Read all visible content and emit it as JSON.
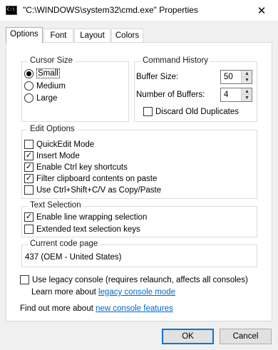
{
  "window": {
    "title": "\"C:\\WINDOWS\\system32\\cmd.exe\" Properties",
    "icon": "cmd-icon",
    "icon_text": "C:\\",
    "close_symbol": "✕"
  },
  "tabs": [
    {
      "label": "Options",
      "active": true
    },
    {
      "label": "Font",
      "active": false
    },
    {
      "label": "Layout",
      "active": false
    },
    {
      "label": "Colors",
      "active": false
    }
  ],
  "cursor_size": {
    "title": "Cursor Size",
    "options": [
      {
        "label": "Small",
        "checked": true
      },
      {
        "label": "Medium",
        "checked": false
      },
      {
        "label": "Large",
        "checked": false
      }
    ]
  },
  "command_history": {
    "title": "Command History",
    "buffer_size_label": "Buffer Size:",
    "buffer_size_value": "50",
    "num_buffers_label": "Number of Buffers:",
    "num_buffers_value": "4",
    "discard_label": "Discard Old Duplicates",
    "discard_checked": false
  },
  "edit_options": {
    "title": "Edit Options",
    "items": [
      {
        "label": "QuickEdit Mode",
        "checked": false
      },
      {
        "label": "Insert Mode",
        "checked": true
      },
      {
        "label": "Enable Ctrl key shortcuts",
        "checked": true
      },
      {
        "label": "Filter clipboard contents on paste",
        "checked": true
      },
      {
        "label": "Use Ctrl+Shift+C/V as Copy/Paste",
        "checked": false
      }
    ]
  },
  "text_selection": {
    "title": "Text Selection",
    "items": [
      {
        "label": "Enable line wrapping selection",
        "checked": true
      },
      {
        "label": "Extended text selection keys",
        "checked": false
      }
    ]
  },
  "code_page": {
    "title": "Current code page",
    "value": "437   (OEM - United States)"
  },
  "legacy": {
    "label": "Use legacy console (requires relaunch, affects all consoles)",
    "checked": false,
    "learn_prefix": "Learn more about ",
    "learn_link": "legacy console mode"
  },
  "find_out": {
    "prefix": "Find out more about ",
    "link": "new console features"
  },
  "buttons": {
    "ok": "OK",
    "cancel": "Cancel"
  }
}
